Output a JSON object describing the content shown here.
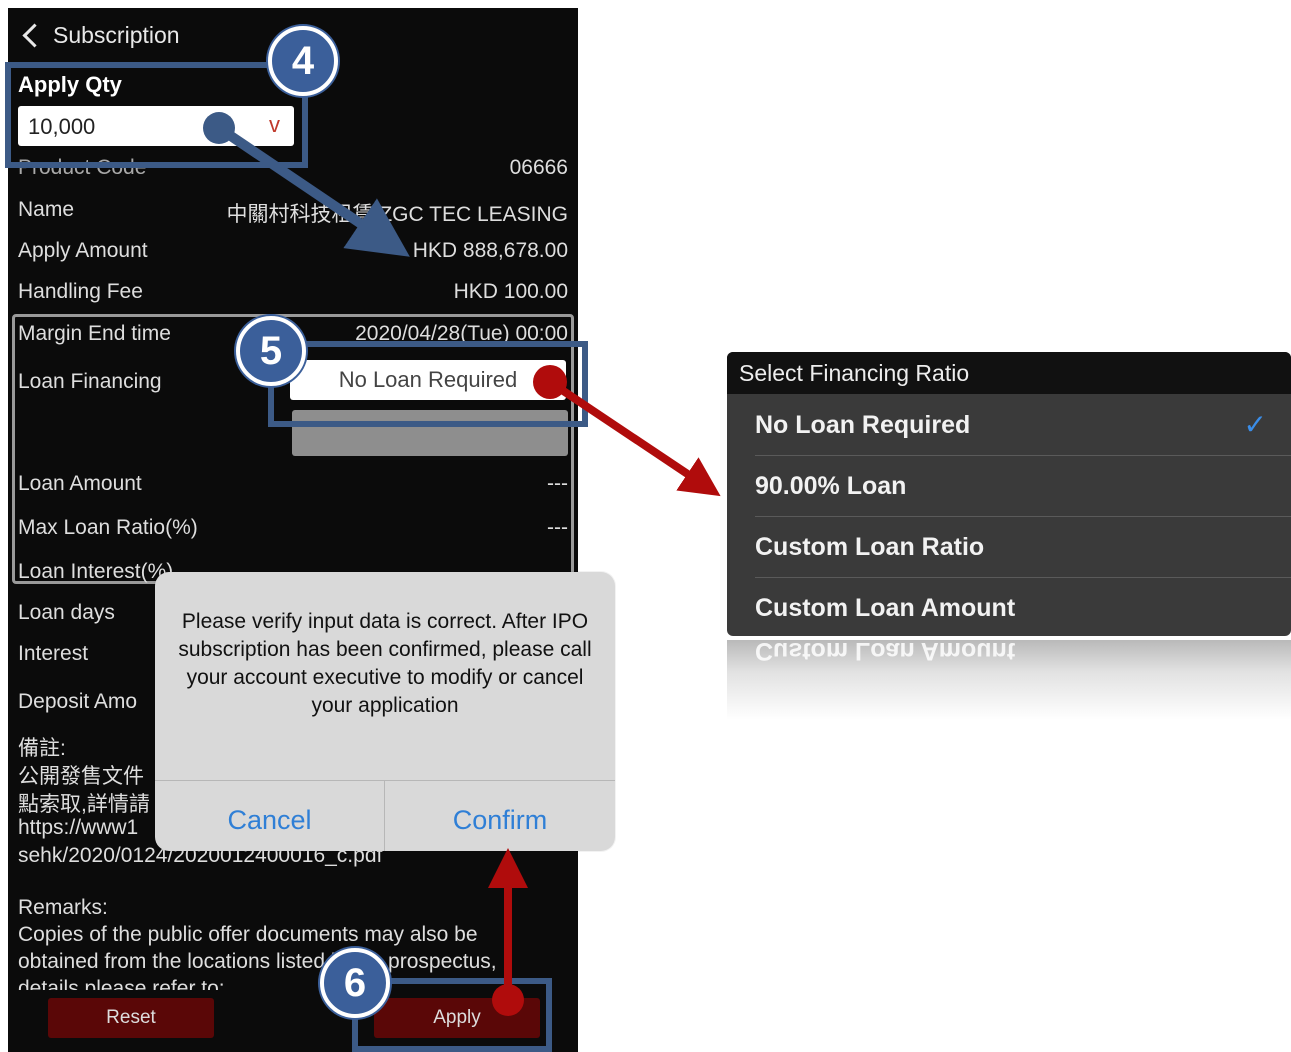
{
  "header": {
    "back_label": "Subscription"
  },
  "apply_qty": {
    "label": "Apply Qty",
    "value": "10,000",
    "caret": "v"
  },
  "details": [
    {
      "label": "Product Code",
      "value": "06666"
    },
    {
      "label": "Name",
      "value": "中關村科技租賃 ZGC TEC LEASING"
    },
    {
      "label": "Apply Amount",
      "value": "HKD 888,678.00"
    },
    {
      "label": "Handling Fee",
      "value": "HKD 100.00"
    }
  ],
  "margin": {
    "end_time_label": "Margin End time",
    "end_time_value": "2020/04/28(Tue) 00:00",
    "loan_financing_label": "Loan Financing",
    "loan_financing_value": "No Loan Required",
    "loan_amount_label": "Loan Amount",
    "loan_amount_value": "---",
    "max_ratio_label": "Max Loan Ratio(%)",
    "max_ratio_value": "---",
    "loan_interest_label": "Loan Interest(%)",
    "loan_days_label": "Loan days",
    "interest_label": "Interest"
  },
  "deposit_label": "Deposit Amo",
  "notes": {
    "label_zh": "備註:",
    "line1": "公開發售文件",
    "line2": "點索取,詳情請",
    "line3": "https://www1",
    "line4": "sehk/2020/0124/2020012400016_c.pdf"
  },
  "remarks": {
    "label": "Remarks:",
    "line1": "Copies of the public offer documents may also be",
    "line2": "obtained from the locations listed in the prospectus,",
    "line3": "details please refer to:"
  },
  "buttons": {
    "reset": "Reset",
    "apply": "Apply"
  },
  "dialog": {
    "message": "Please verify input data is correct. After IPO subscription has been confirmed, please call your account executive to modify or cancel your application",
    "cancel": "Cancel",
    "confirm": "Confirm"
  },
  "picker": {
    "title": "Select Financing Ratio",
    "options": [
      "No Loan Required",
      "90.00% Loan",
      "Custom Loan Ratio",
      "Custom Loan Amount"
    ],
    "selected_index": 0,
    "checkmark": "✓",
    "reflection_text": "Custom Loan Amount"
  },
  "callouts": {
    "step4": "4",
    "step5": "5",
    "step6": "6"
  },
  "colors": {
    "callout_blue": "#3c5a86",
    "arrow_red": "#b00c0c",
    "link_blue": "#2f7fd6",
    "apply_red": "#5a0707"
  }
}
